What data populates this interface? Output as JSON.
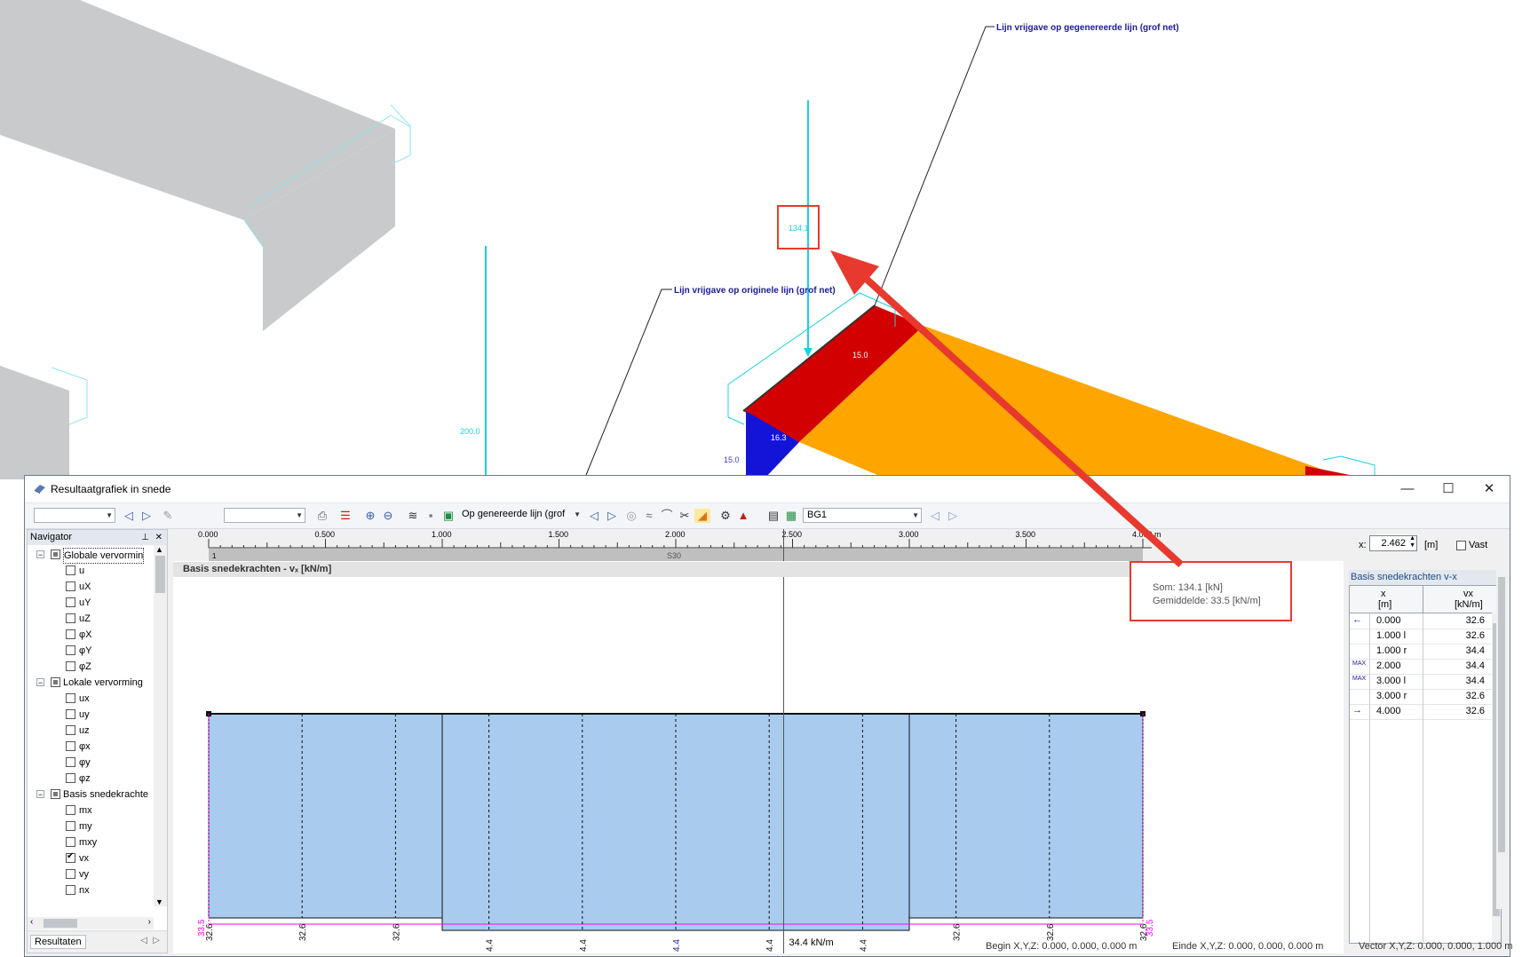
{
  "model_labels": {
    "line_label_generated": "Lijn vrijgave op gegenereerde lijn (grof net)",
    "line_label_original": "Lijn vrijgave op originele lijn (grof net)",
    "value_134": "134.1",
    "value_200": "200.0",
    "value_15_top": "15.0",
    "value_16": "16.3",
    "value_15_side": "15.0"
  },
  "window": {
    "title": "Resultaatgrafiek in snede",
    "minimize": "—",
    "maximize": "☐",
    "close": "✕"
  },
  "toolbar": {
    "combo1": "",
    "combo2": "",
    "mode_select": "Op genereerde lijn (grof",
    "case_select": "BG1"
  },
  "navigator": {
    "title": "Navigator",
    "groups": [
      {
        "label": "Globale vervormin",
        "items": [
          "u",
          "uX",
          "uY",
          "uZ",
          "φX",
          "φY",
          "φZ"
        ]
      },
      {
        "label": "Lokale vervorming",
        "items": [
          "ux",
          "uy",
          "uz",
          "φx",
          "φy",
          "φz"
        ]
      },
      {
        "label": "Basis snedekrachte",
        "items": [
          "mx",
          "my",
          "mxy",
          "vx",
          "vy",
          "nx"
        ]
      }
    ],
    "checked_item": "vx",
    "footer_tab": "Resultaten"
  },
  "ruler": {
    "ticks": [
      "0.000",
      "0.500",
      "1.000",
      "1.500",
      "2.000",
      "2.500",
      "3.000",
      "3.500",
      "4.000 m"
    ],
    "start_node": "1",
    "segment_label": "S30"
  },
  "graph": {
    "header": "Basis snedekrachten - vₓ [kN/m]",
    "cursor_label": "34.4 kN/m",
    "left_end_label": "33.5",
    "right_end_label": "33.5"
  },
  "chart_data": {
    "type": "area",
    "title": "Basis snedekrachten - vₓ [kN/m]",
    "xlabel": "x [m]",
    "ylabel": "vx [kN/m]",
    "xlim": [
      0,
      4
    ],
    "x": [
      0.0,
      1.0,
      1.0,
      3.0,
      3.0,
      4.0
    ],
    "values": [
      32.6,
      32.6,
      34.4,
      34.4,
      32.6,
      32.6
    ],
    "subdivision_labels": [
      {
        "x": 0.4,
        "label": "32.6"
      },
      {
        "x": 0.8,
        "label": "32.6"
      },
      {
        "x": 1.2,
        "label": "4.4"
      },
      {
        "x": 1.6,
        "label": "4.4"
      },
      {
        "x": 2.0,
        "label": "4.4"
      },
      {
        "x": 2.4,
        "label": "4.4"
      },
      {
        "x": 2.8,
        "label": "4.4"
      },
      {
        "x": 3.2,
        "label": "32.6"
      },
      {
        "x": 3.6,
        "label": "32.6"
      },
      {
        "x": 0.0,
        "label": "32.6"
      },
      {
        "x": 4.0,
        "label": "32.6"
      }
    ],
    "cursor_x": 2.462,
    "sum": "134.1 [kN]",
    "average": "33.5 [kN/m]"
  },
  "info": {
    "sum_label": "Som: 134.1 [kN]",
    "avg_label": "Gemiddelde: 33.5 [kN/m]"
  },
  "position": {
    "x_label": "x:",
    "x_value": "2.462",
    "unit": "[m]",
    "fixed_label": "Vast"
  },
  "results_table": {
    "title": "Basis snedekrachten v-x",
    "col_x": "x",
    "col_x_unit": "[m]",
    "col_v": "vx",
    "col_v_unit": "[kN/m]",
    "rows": [
      {
        "marker": "←",
        "x": "0.000",
        "v": "32.6"
      },
      {
        "marker": "",
        "x": "1.000 l",
        "v": "32.6"
      },
      {
        "marker": "",
        "x": "1.000 r",
        "v": "34.4"
      },
      {
        "marker": "MAX",
        "x": "2.000",
        "v": "34.4"
      },
      {
        "marker": "MAX",
        "x": "3.000 l",
        "v": "34.4"
      },
      {
        "marker": "",
        "x": "3.000 r",
        "v": "32.6"
      },
      {
        "marker": "→",
        "x": "4.000",
        "v": "32.6"
      }
    ]
  },
  "status": {
    "begin": "Begin X,Y,Z:  0.000, 0.000, 0.000 m",
    "end": "Einde X,Y,Z:  0.000, 0.000, 0.000 m",
    "vector": "Vector X,Y,Z:  0.000, 0.000, 1.000 m"
  },
  "colors": {
    "diagram_fill": "#a9cbee",
    "annotation_red": "#e8392e",
    "cyan_load": "#17d3e8",
    "slab_orange": "#ffa500",
    "slab_red": "#d20000",
    "slab_blue": "#1414d8",
    "wall_gray": "#c8cacc"
  }
}
